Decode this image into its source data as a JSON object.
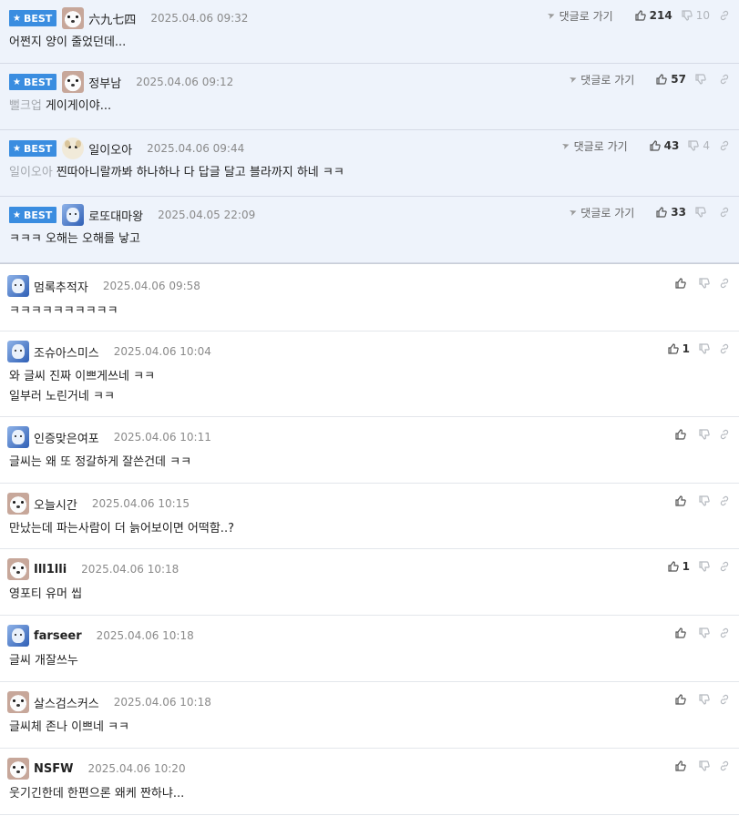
{
  "labels": {
    "best": "BEST",
    "reply_link": "댓글로 가기"
  },
  "best_comments": [
    {
      "nick": "六九七四",
      "avatar": "dog",
      "date": "2025.04.06 09:32",
      "mention": "",
      "text": "어쩐지 양이 줄었던데...",
      "likes": "214",
      "dislikes": "10"
    },
    {
      "nick": "정부남",
      "avatar": "dog",
      "date": "2025.04.06 09:12",
      "mention": "뻘크업",
      "text": "게이게이야...",
      "likes": "57",
      "dislikes": ""
    },
    {
      "nick": "일이오아",
      "avatar": "pup",
      "date": "2025.04.06 09:44",
      "mention": "일이오아",
      "text": "찐따아니랄까봐 하나하나 다 답글 달고 블라까지 하네 ㅋㅋ",
      "likes": "43",
      "dislikes": "4"
    },
    {
      "nick": "로또대마왕",
      "avatar": "blue",
      "date": "2025.04.05 22:09",
      "mention": "",
      "text": "ㅋㅋㅋ 오해는 오해를 낳고",
      "likes": "33",
      "dislikes": ""
    }
  ],
  "comments": [
    {
      "nick": "멈록추적자",
      "avatar": "blue",
      "bold": false,
      "date": "2025.04.06 09:58",
      "lines": [
        "ㅋㅋㅋㅋㅋㅋㅋㅋㅋㅋ"
      ],
      "likes": ""
    },
    {
      "nick": "조슈아스미스",
      "avatar": "blue",
      "bold": false,
      "date": "2025.04.06 10:04",
      "lines": [
        "와 글씨 진짜 이쁘게쓰네 ㅋㅋ",
        "일부러 노린거네 ㅋㅋ"
      ],
      "likes": "1"
    },
    {
      "nick": "인증맞은여포",
      "avatar": "blue",
      "bold": false,
      "date": "2025.04.06 10:11",
      "lines": [
        "글씨는 왜 또 정갈하게 잘쓴건데 ㅋㅋ"
      ],
      "likes": ""
    },
    {
      "nick": "오늘시간",
      "avatar": "dog",
      "bold": false,
      "date": "2025.04.06 10:15",
      "lines": [
        "만났는데 파는사람이 더 늙어보이면 어떡함..?"
      ],
      "likes": ""
    },
    {
      "nick": "Ill1lli",
      "avatar": "dog",
      "bold": true,
      "date": "2025.04.06 10:18",
      "lines": [
        "영포티 유머 씹"
      ],
      "likes": "1"
    },
    {
      "nick": "farseer",
      "avatar": "blue",
      "bold": true,
      "date": "2025.04.06 10:18",
      "lines": [
        "글씨 개잘쓰누"
      ],
      "likes": ""
    },
    {
      "nick": "살스검스커스",
      "avatar": "dog",
      "bold": false,
      "date": "2025.04.06 10:18",
      "lines": [
        "글씨체 존나 이쁘네 ㅋㅋ"
      ],
      "likes": ""
    },
    {
      "nick": "NSFW",
      "avatar": "dog",
      "bold": true,
      "date": "2025.04.06 10:20",
      "lines": [
        "웃기긴한데 한편으론 왜케 짠하냐..."
      ],
      "likes": ""
    }
  ]
}
